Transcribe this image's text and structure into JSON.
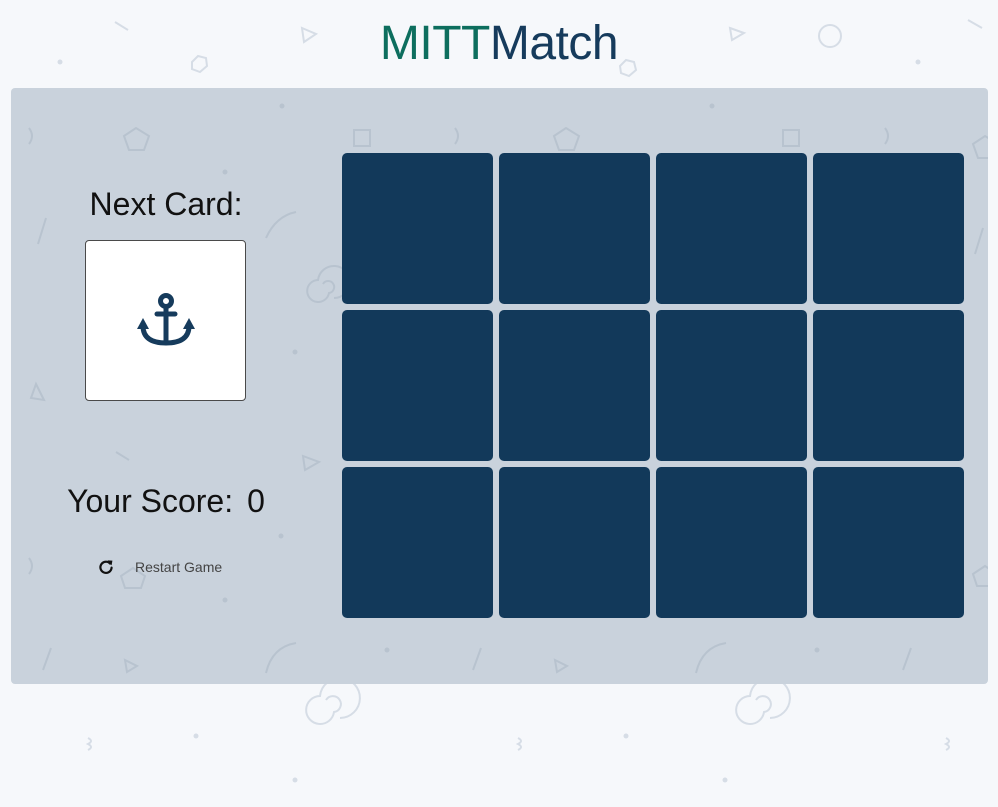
{
  "title": {
    "part1": "MITT",
    "part2": "Match"
  },
  "next_card": {
    "label": "Next Card:",
    "icon": "anchor-icon",
    "icon_color": "#163b5c"
  },
  "score": {
    "label": "Your Score:",
    "value": "0"
  },
  "restart": {
    "label": "Restart Game",
    "icon": "refresh-icon"
  },
  "board": {
    "rows": 3,
    "columns": 4,
    "card_back_color": "#12395a",
    "cards": [
      {
        "state": "face-down"
      },
      {
        "state": "face-down"
      },
      {
        "state": "face-down"
      },
      {
        "state": "face-down"
      },
      {
        "state": "face-down"
      },
      {
        "state": "face-down"
      },
      {
        "state": "face-down"
      },
      {
        "state": "face-down"
      },
      {
        "state": "face-down"
      },
      {
        "state": "face-down"
      },
      {
        "state": "face-down"
      },
      {
        "state": "face-down"
      }
    ]
  },
  "colors": {
    "page_background": "#f6f8fb",
    "panel_background": "#c9d2dc",
    "title_part1": "#0d6e5e",
    "title_part2": "#163b5c"
  }
}
